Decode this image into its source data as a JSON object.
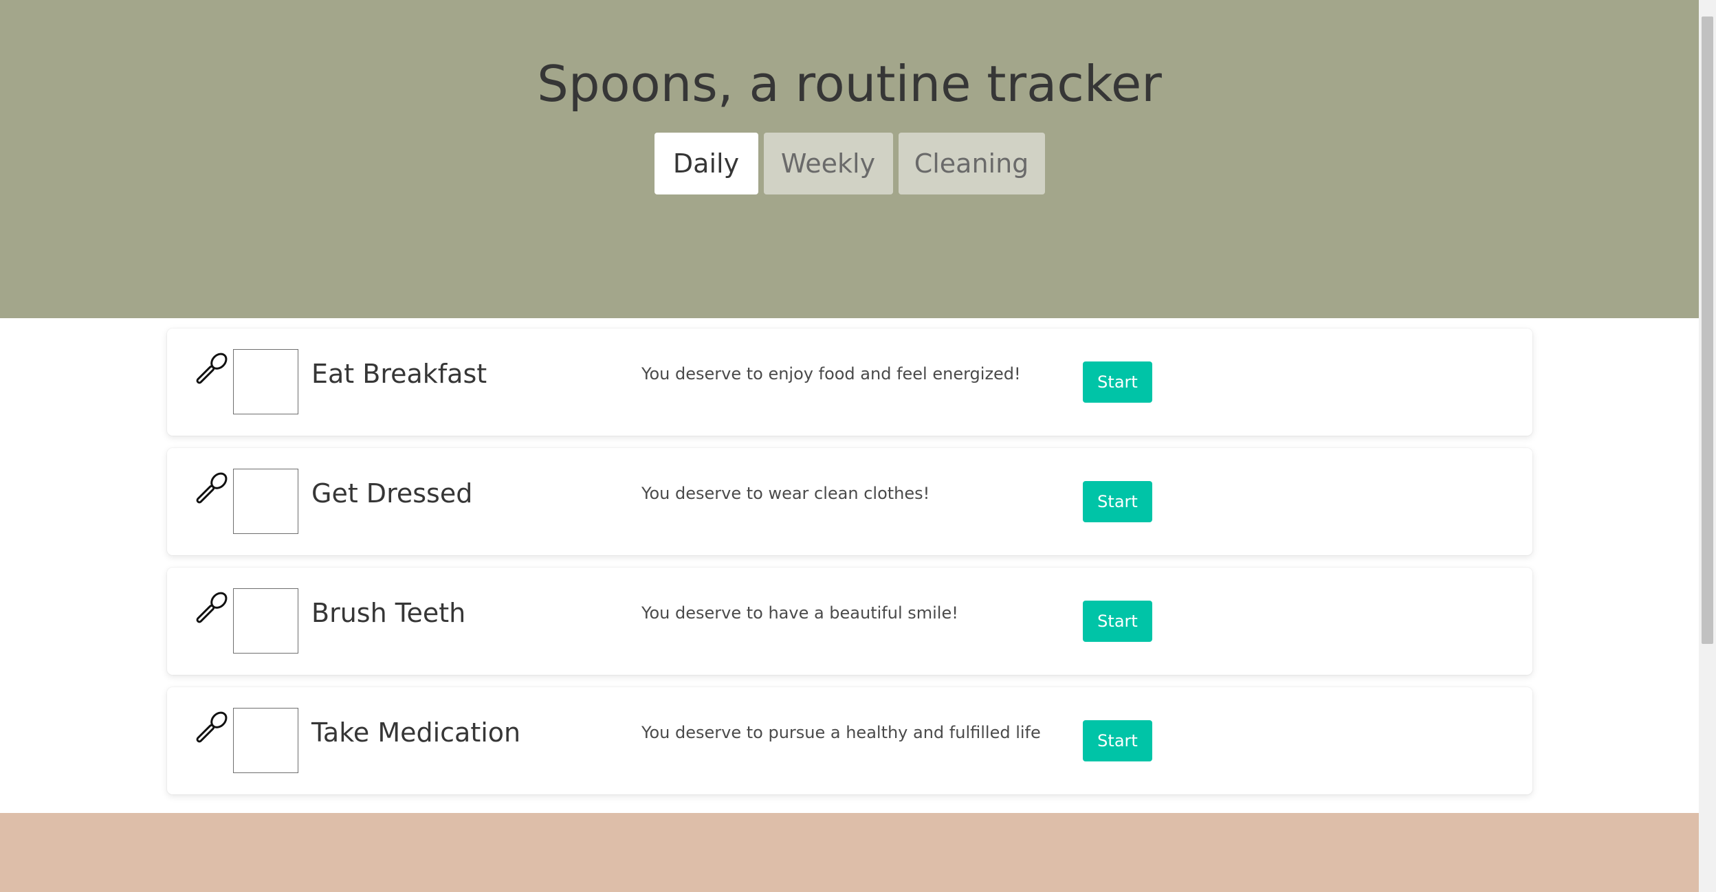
{
  "header": {
    "title": "Spoons, a routine tracker",
    "tabs": [
      {
        "label": "Daily",
        "active": true
      },
      {
        "label": "Weekly",
        "active": false
      },
      {
        "label": "Cleaning",
        "active": false
      }
    ]
  },
  "tasks": [
    {
      "name": "Eat Breakfast",
      "message": "You deserve to enjoy food and feel energized!",
      "button": "Start",
      "checked": false
    },
    {
      "name": "Get Dressed",
      "message": "You deserve to wear clean clothes!",
      "button": "Start",
      "checked": false
    },
    {
      "name": "Brush Teeth",
      "message": "You deserve to have a beautiful smile!",
      "button": "Start",
      "checked": false
    },
    {
      "name": "Take Medication",
      "message": "You deserve to pursue a healthy and fulfilled life",
      "button": "Start",
      "checked": false
    }
  ],
  "colors": {
    "hero": "#a3a68b",
    "footer": "#ddbea9",
    "button": "#00c4a7",
    "tab_inactive": "#d1d2c5"
  },
  "icons": {
    "task": "spoon-icon"
  }
}
